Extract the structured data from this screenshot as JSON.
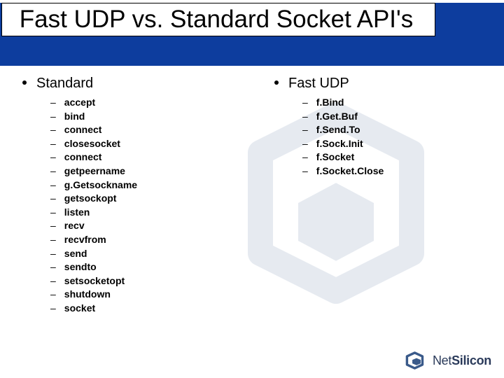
{
  "title": "Fast UDP vs. Standard Socket API's",
  "columns": [
    {
      "heading": "Standard",
      "items": [
        "accept",
        "bind",
        "connect",
        "closesocket",
        "connect",
        "getpeername",
        "g.Getsockname",
        "getsockopt",
        "listen",
        "recv",
        "recvfrom",
        "send",
        "sendto",
        "setsocketopt",
        "shutdown",
        "socket"
      ]
    },
    {
      "heading": "Fast UDP",
      "items": [
        "f.Bind",
        "f.Get.Buf",
        "f.Send.To",
        "f.Sock.Init",
        "f.Socket",
        "f.Socket.Close"
      ]
    }
  ],
  "brand": {
    "net": "Net",
    "silicon": "Silicon"
  }
}
